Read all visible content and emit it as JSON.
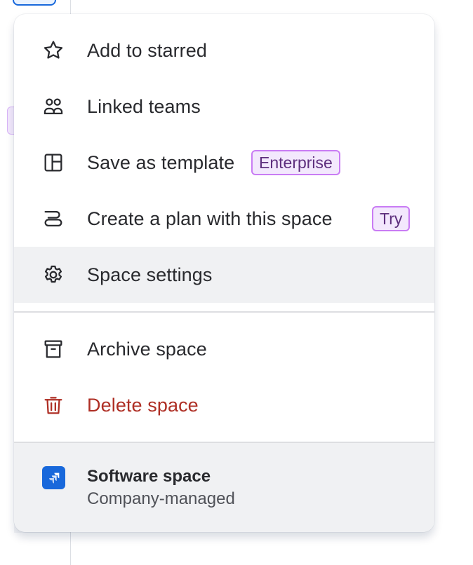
{
  "menu": {
    "items": [
      {
        "label": "Add to starred",
        "icon": "star-icon"
      },
      {
        "label": "Linked teams",
        "icon": "people-icon"
      },
      {
        "label": "Save as template",
        "icon": "template-icon",
        "badge": "Enterprise"
      },
      {
        "label": "Create a plan with this space",
        "icon": "plan-icon",
        "badge": "Try"
      },
      {
        "label": "Space settings",
        "icon": "gear-icon",
        "active": true
      }
    ],
    "secondary_items": [
      {
        "label": "Archive space",
        "icon": "archive-icon"
      },
      {
        "label": "Delete space",
        "icon": "trash-icon",
        "danger": true
      }
    ],
    "footer": {
      "name": "Software space",
      "type": "Company-managed",
      "icon": "jira-software-logo"
    }
  },
  "colors": {
    "danger": "#ae2e24",
    "badge_bg": "#f3e8fd",
    "badge_border": "#c97cf4",
    "badge_text": "#5e2f7e",
    "active_bg": "#f0f1f3",
    "logo": "#1868db"
  }
}
